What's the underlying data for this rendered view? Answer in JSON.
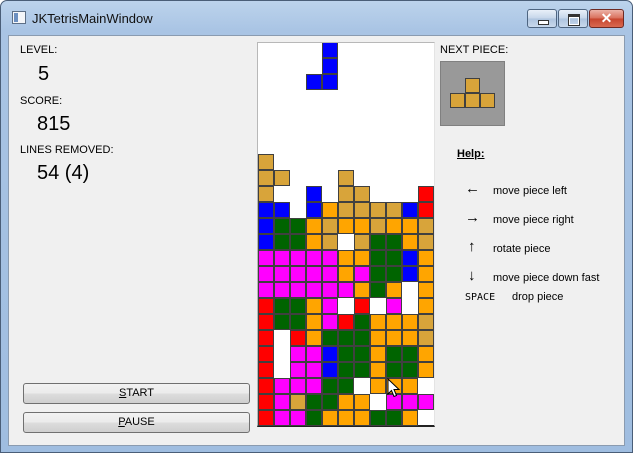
{
  "window": {
    "title": "JKTetrisMainWindow",
    "close_glyph": "✕"
  },
  "stats": {
    "level_label": "LEVEL:",
    "level_value": "5",
    "score_label": "SCORE:",
    "score_value": "815",
    "lines_label": "LINES REMOVED:",
    "lines_value": "54 (4)"
  },
  "next": {
    "label": "NEXT PIECE:",
    "cells": [
      [
        1,
        0
      ],
      [
        0,
        1
      ],
      [
        1,
        1
      ],
      [
        2,
        1
      ]
    ],
    "color": "#d8a43a"
  },
  "help": {
    "title": "Help:",
    "items": [
      {
        "key": "←",
        "text": "move piece left"
      },
      {
        "key": "→",
        "text": "move piece right"
      },
      {
        "key": "↑",
        "text": "rotate piece"
      },
      {
        "key": "↓",
        "text": "move piece down fast"
      },
      {
        "key": "SPACE",
        "text": "drop piece"
      }
    ]
  },
  "buttons": {
    "start": {
      "mnemonic": "S",
      "rest": "TART"
    },
    "pause": {
      "mnemonic": "P",
      "rest": "AUSE"
    }
  },
  "colors": {
    "R": "#ff0000",
    "B": "#0000ff",
    "G": "#006400",
    "M": "#ff00ff",
    "O": "#ffa500",
    "Y": "#d8a43a",
    "outline": "#404040",
    "board_bg": "#ffffff",
    "next_bg": "#999999"
  },
  "board": {
    "cols": 11,
    "rows": 24,
    "grid": [
      "....B......",
      "....B......",
      "...BB......",
      "...........",
      "...........",
      "...........",
      "...........",
      "Y..........",
      "YY...Y.....",
      "Y..B.YY...R",
      "BB.BOYYYYBR",
      "BGGOYOOYOOY",
      "BGGOY.YGGOY",
      "MMMMMOOGGBO",
      "MMMMMOMGGBO",
      "MMMMMMOGO.O",
      "RGGOM.R.M.O",
      "RGGOMRGOOOY",
      "R.ROGGGOOOY",
      "R.MMBGGOGGO",
      "R.MMBGGOGGO",
      "RMMMGG.OOO.",
      "RMYGGOO.MMM",
      "RMMGOOOGGO.",
      "R.MOORGGGGG"
    ]
  }
}
